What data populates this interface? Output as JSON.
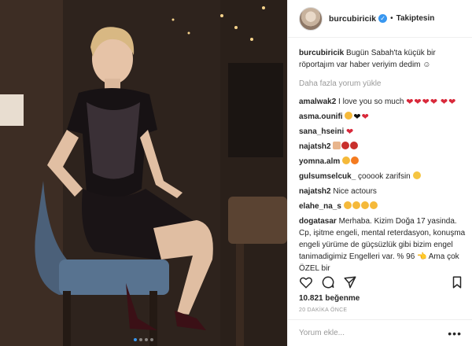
{
  "post": {
    "username": "burcubiricik",
    "follow_status": "Takiptesin",
    "separator": "•",
    "caption_user": "burcubiricik",
    "caption_text": "Bugün Sabah'ta küçük bir röportajım var haber veriyim dedim ☺",
    "load_more": "Daha fazla yorum yükle",
    "likes": "10.821 beğenme",
    "timestamp": "20 DAKİKA ÖNCE",
    "comment_placeholder": "Yorum ekle...",
    "more_options": "•••",
    "carousel": {
      "slide_count": 4,
      "active_index": 0
    }
  },
  "comments": [
    {
      "user": "amalwak2",
      "text": "I love you so much",
      "emoji": [
        "heart",
        "heart",
        "heart",
        "heart",
        "heart",
        "heart"
      ]
    },
    {
      "user": "asma.ounifi",
      "text": "",
      "emoji": [
        "heart-eyes-face",
        "black-heart",
        "heart"
      ]
    },
    {
      "user": "sana_hseini",
      "text": "",
      "emoji": [
        "heart"
      ]
    },
    {
      "user": "najatsh2",
      "text": "",
      "emoji": [
        "thumbs-up",
        "rose",
        "rose"
      ]
    },
    {
      "user": "yomna.alm",
      "text": "",
      "emoji": [
        "heart-eyes-face",
        "fire"
      ]
    },
    {
      "user": "gulsumselcuk_",
      "text": "çooook zarifsin",
      "emoji": [
        "smiling-face"
      ]
    },
    {
      "user": "najatsh2",
      "text": "Nice actours",
      "emoji": []
    },
    {
      "user": "elahe_na_s",
      "text": "",
      "emoji": [
        "heart-eyes-face",
        "heart-eyes-face",
        "heart-eyes-face",
        "heart-eyes-face"
      ]
    },
    {
      "user": "dogatasar",
      "text": "Merhaba. Kizim Doğa 17 yasinda. Cp, işitme engeli, mental reterdasyon, konuşma engeli yürüme de güçsüzlük gibi bizim engel tanimadigimiz Engelleri var. % 96 👈 Ama çok ÖZEL bir",
      "emoji": []
    }
  ],
  "icons": {
    "like": "heart-outline-icon",
    "comment": "comment-bubble-icon",
    "share": "share-arrow-icon",
    "save": "bookmark-icon",
    "verified": "verified-badge-icon"
  },
  "colors": {
    "accent": "#3897f0",
    "heart": "#d8283a",
    "text": "#262626",
    "muted": "#999999"
  }
}
